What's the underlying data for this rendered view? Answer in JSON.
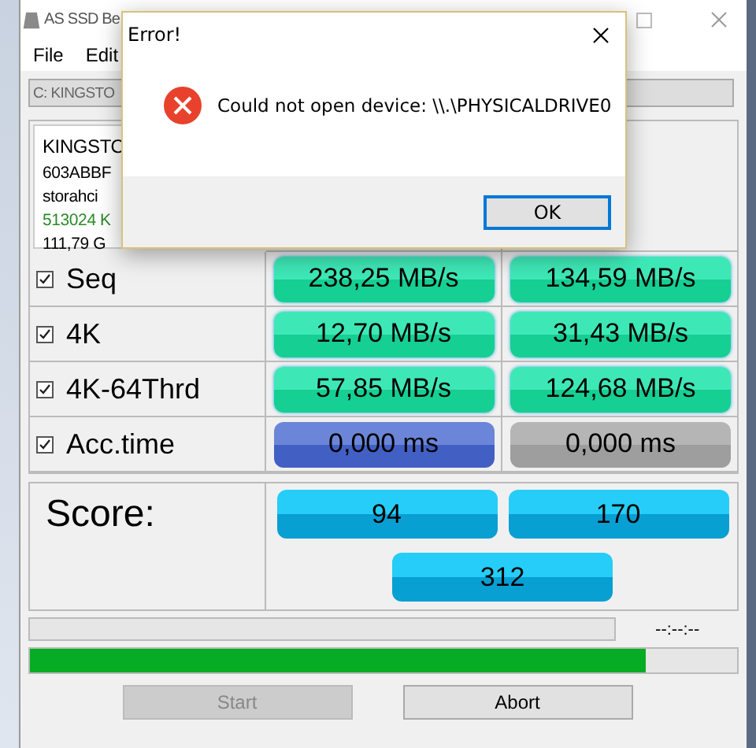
{
  "window": {
    "title": "AS SSD Be"
  },
  "menu": [
    {
      "label": "File"
    },
    {
      "label": "Edit"
    }
  ],
  "drive_select": {
    "value": "C: KINGSTO"
  },
  "drive_info": [
    {
      "text": "KINGSTO",
      "kind": "name"
    },
    {
      "text": "603ABBF",
      "kind": "plain"
    },
    {
      "text": "storahci",
      "kind": "plain"
    },
    {
      "text": "513024 K",
      "kind": "status"
    },
    {
      "text": "111,79 G",
      "kind": "plain"
    }
  ],
  "tests": [
    {
      "label": "Seq",
      "checked": true,
      "kind": "speed",
      "read": "238,25 MB/s",
      "write": "134,59 MB/s"
    },
    {
      "label": "4K",
      "checked": true,
      "kind": "speed",
      "read": "12,70 MB/s",
      "write": "31,43 MB/s"
    },
    {
      "label": "4K-64Thrd",
      "checked": true,
      "kind": "speed",
      "read": "57,85 MB/s",
      "write": "124,68 MB/s"
    },
    {
      "label": "Acc.time",
      "checked": true,
      "kind": "access",
      "read": "0,000 ms",
      "write": "0,000 ms"
    }
  ],
  "score": {
    "label": "Score:",
    "read": "94",
    "write": "170",
    "total": "312"
  },
  "progress": {
    "level": 0,
    "time": "--:--:--"
  },
  "overall_progress": {
    "level": 0.87
  },
  "buttons": [
    {
      "label": "Start",
      "disabled": true
    },
    {
      "label": "Abort",
      "disabled": false
    }
  ],
  "dialog": {
    "title": "Error!",
    "message": "Could not open device: \\\\.\\PHYSICALDRIVE0",
    "buttons": [
      "OK"
    ]
  }
}
